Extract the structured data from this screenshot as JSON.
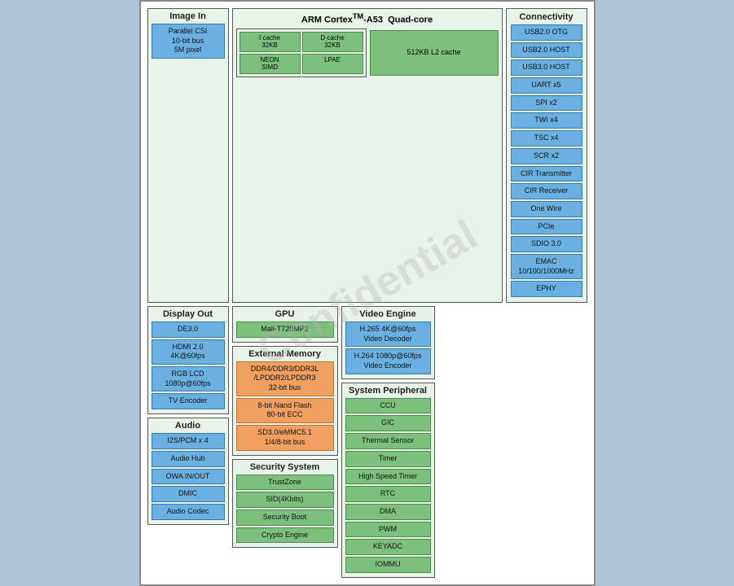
{
  "watermark": "Confidential",
  "image_in": {
    "title": "Image In",
    "items": [
      "Parallel CSI",
      "10-bit bus",
      "5M pixel"
    ]
  },
  "display_out": {
    "title": "Display Out",
    "items": [
      "DE3.0",
      "HDMI 2.0\n4K@60fps",
      "RGB LCD\n1080p@60fps",
      "TV Encoder"
    ]
  },
  "audio": {
    "title": "Audio",
    "items": [
      "I2S/PCM x 4",
      "Audio Hub",
      "OWA IN/OUT",
      "DMIC",
      "Audio Codec"
    ]
  },
  "arm": {
    "title": "ARM Cortex™-A53  Quad-core",
    "icache": "I cache\n32KB",
    "dcache": "D cache\n32KB",
    "neon": "NEON\nSIMD",
    "lpae": "LPAE",
    "l2cache": "512KB L2 cache"
  },
  "gpu": {
    "title": "GPU",
    "items": [
      "Mali-T720MP2"
    ]
  },
  "ext_mem": {
    "title": "External Memory",
    "items": [
      "DDR4/DDR3/DDR3L\n/LPDDR2/LPDDR3\n32-bit bus",
      "8-bit Nand Flash\n80-bit ECC",
      "SD3.0/eMMC5.1\n1/4/8-bit bus"
    ]
  },
  "security": {
    "title": "Security System",
    "items": [
      "TrustZone",
      "SID(4Kbits)",
      "Security Boot",
      "Crypto Engine"
    ]
  },
  "video_engine": {
    "title": "Video Engine",
    "items": [
      "H.265  4K@60fps\nVideo Decoder",
      "H.264 1080p@60fps\nVideo Encoder"
    ]
  },
  "sys_peripheral": {
    "title": "System Peripheral",
    "items": [
      "CCU",
      "GIC",
      "Thermal Sensor",
      "Timer",
      "High Speed Timer",
      "RTC",
      "DMA",
      "PWM",
      "KEYADC",
      "IOMMU"
    ]
  },
  "connectivity": {
    "title": "Connectivity",
    "items": [
      "USB2.0 OTG",
      "USB2.0 HOST",
      "USB3.0 HOST",
      "UART x5",
      "SPI x2",
      "TWI x4",
      "TSC x4",
      "SCR x2",
      "CIR Transmitter",
      "CIR Receiver",
      "One Wire",
      "PCIe",
      "SDIO 3.0",
      "EMAC\n10/100/1000MHz",
      "EPHY"
    ]
  }
}
